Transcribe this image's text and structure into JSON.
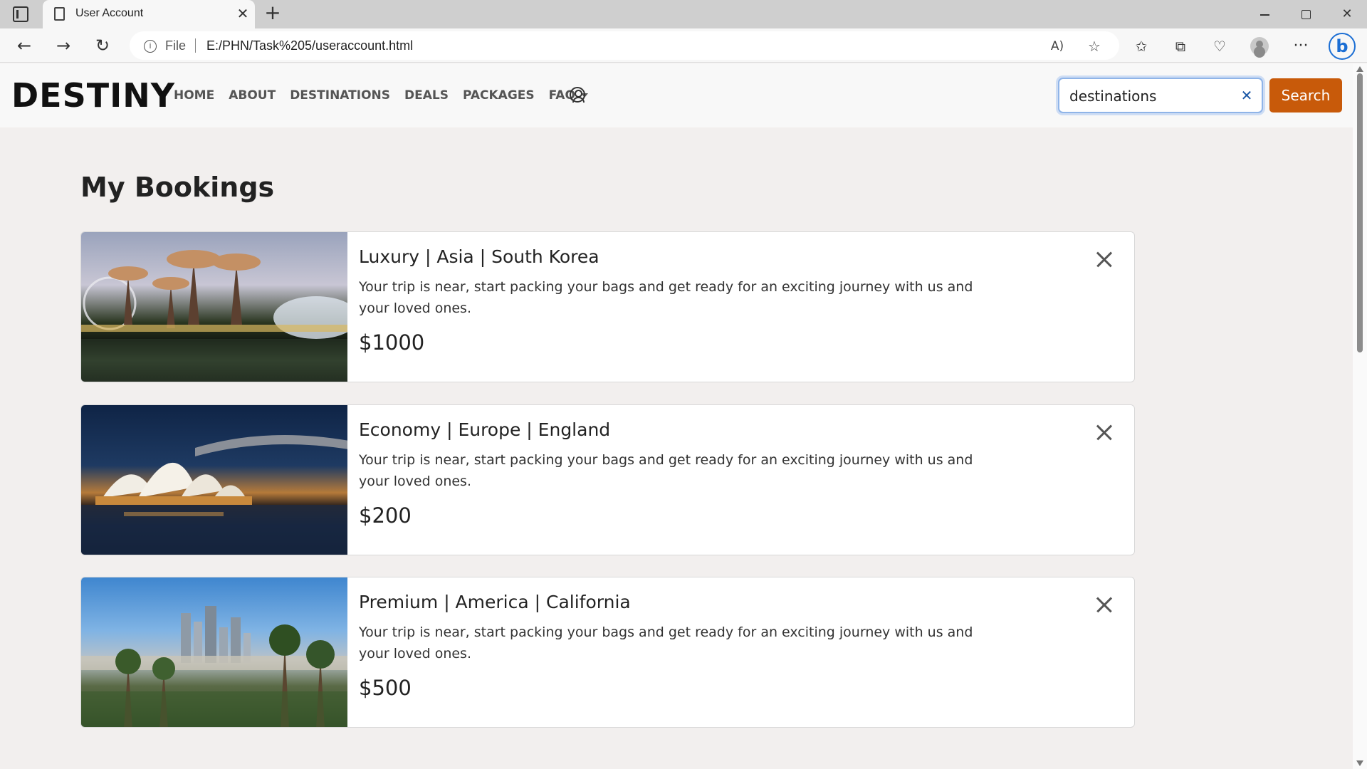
{
  "browser": {
    "tab_title": "User Account",
    "tab_close": "✕",
    "new_tab": "+",
    "file_label": "File",
    "url": "E:/PHN/Task%205/useraccount.html",
    "back": "←",
    "forward": "→",
    "reload": "↻",
    "read_aloud": "A)",
    "favorite": "☆",
    "favorites_bar": "✩",
    "collections": "⧉",
    "more": "···",
    "copilot": "b",
    "win_close": "✕"
  },
  "navbar": {
    "brand": "DESTINY",
    "links": [
      "HOME",
      "ABOUT",
      "DESTINATIONS",
      "DEALS",
      "PACKAGES",
      "FAQ"
    ],
    "search_value": "destinations",
    "search_clear": "✕",
    "search_button": "Search"
  },
  "page": {
    "heading": "My Bookings"
  },
  "bookings": [
    {
      "title": "Luxury | Asia | South Korea",
      "description": "Your trip is near, start packing your bags and get ready for an exciting journey with us and your loved ones.",
      "price": "$1000"
    },
    {
      "title": "Economy | Europe | England",
      "description": "Your trip is near, start packing your bags and get ready for an exciting journey with us and your loved ones.",
      "price": "$200"
    },
    {
      "title": "Premium | America | California",
      "description": "Your trip is near, start packing your bags and get ready for an exciting journey with us and your loved ones.",
      "price": "$500"
    }
  ],
  "colors": {
    "accent": "#c85a0a",
    "page_bg": "#f2efee",
    "navbar_bg": "#f8f8f8"
  }
}
